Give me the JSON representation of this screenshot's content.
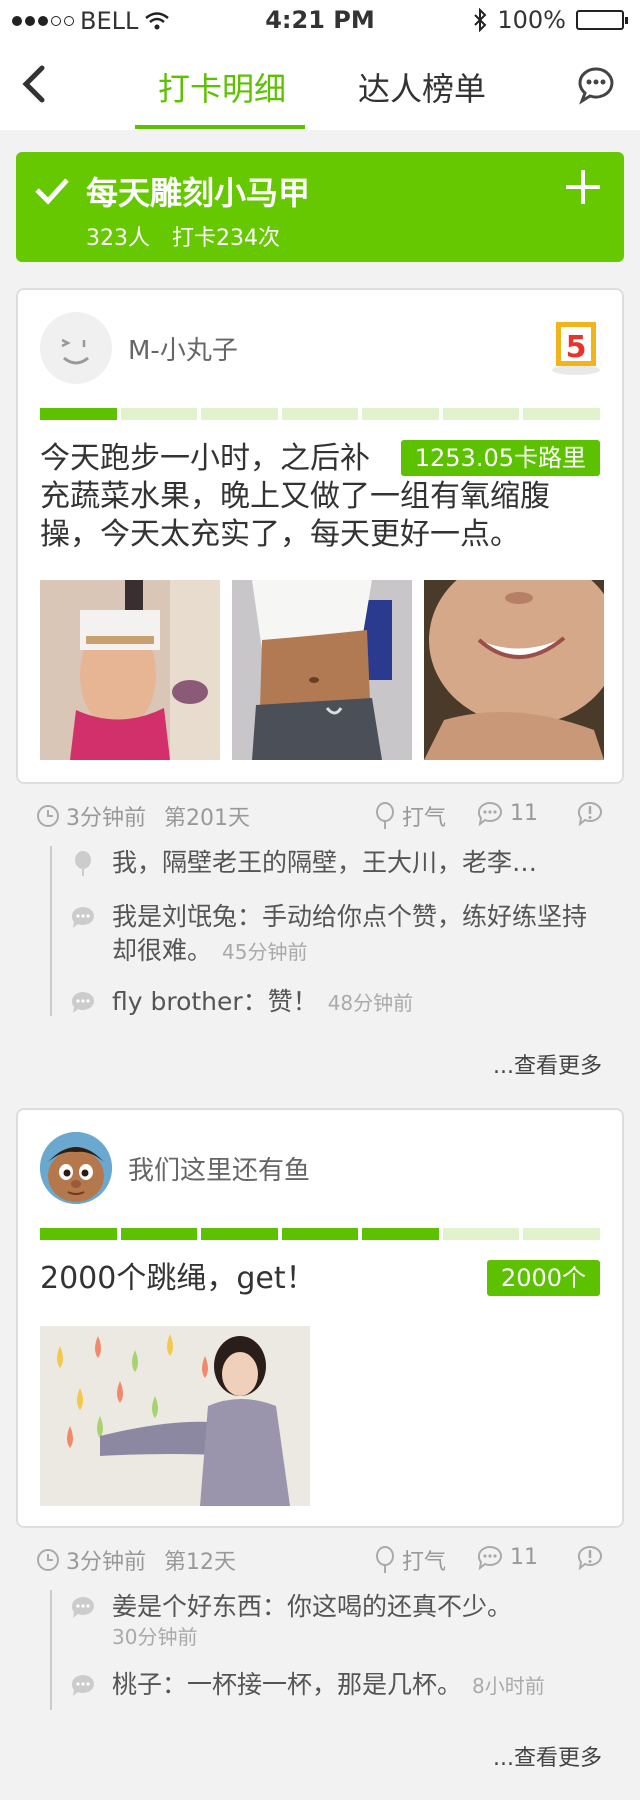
{
  "status_bar": {
    "carrier": "BELL",
    "time": "4:21 PM",
    "battery": "100%",
    "battery_level": 1.0
  },
  "nav": {
    "tabs": [
      "打卡明细",
      "达人榜单"
    ],
    "active_tab": 0
  },
  "banner": {
    "title": "每天雕刻小马甲",
    "people": "323人",
    "checkins": "打卡234次"
  },
  "colors": {
    "accent": "#5cc200",
    "banner": "#65c800",
    "badge": "#f1b51c"
  },
  "posts": [
    {
      "username": "M-小丸子",
      "badge_number": "5",
      "progress": 0.143,
      "tag": "1253.05卡路里",
      "text": "今天跑步一小时，之后补充蔬菜水果，晚上又做了一组有氧缩腹操，今天太充实了，每天更好一点。",
      "time": "3分钟前",
      "day": "第201天",
      "cheer_label": "打气",
      "comment_count": "11",
      "likes": "我，隔壁老王的隔壁，王大川，老李…",
      "comments": [
        {
          "text": "我是刘氓兔：手动给你点个赞，练好练坚持却很难。",
          "time": "45分钟前"
        },
        {
          "text": "fly brother：赞！",
          "time": "48分钟前"
        }
      ],
      "more_label": "...查看更多"
    },
    {
      "username": "我们这里还有鱼",
      "progress": 0.714,
      "tag": "2000个",
      "text": "2000个跳绳，get！",
      "time": "3分钟前",
      "day": "第12天",
      "cheer_label": "打气",
      "comment_count": "11",
      "comments": [
        {
          "text": "姜是个好东西：你这喝的还真不少。",
          "time": "30分钟前"
        },
        {
          "text": "桃子：一杯接一杯，那是几杯。",
          "time": "8小时前"
        }
      ],
      "more_label": "...查看更多"
    }
  ]
}
